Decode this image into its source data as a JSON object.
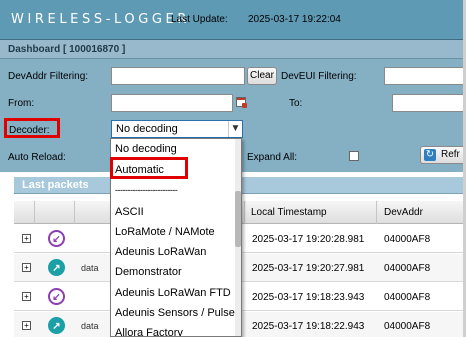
{
  "header": {
    "logo": "WIRELESS-LOGGER",
    "last_update_label": "Last Update:",
    "last_update_value": "2025-03-17 19:22:04"
  },
  "dashboard": {
    "title": "Dashboard [ 100016870 ]"
  },
  "filters": {
    "devaddr_label": "DevAddr Filtering:",
    "clear_label": "Clear",
    "deveui_label": "DevEUI Filtering:",
    "from_label": "From:",
    "to_label": "To:",
    "decoder_label": "Decoder:",
    "decoder_value": "No decoding",
    "auto_reload_label": "Auto Reload:",
    "expand_all_label": "Expand All:",
    "refresh_label": "Refr"
  },
  "dropdown": {
    "items": [
      "No decoding",
      "Automatic",
      "-------------------------",
      "ASCII",
      "LoRaMote / NAMote",
      "Adeunis LoRaWan",
      "Demonstrator",
      "Adeunis LoRaWan FTD",
      "Adeunis Sensors / Pulse",
      "Allora Factory"
    ]
  },
  "packets": {
    "title": "Last packets",
    "columns": {
      "timestamp": "Local Timestamp",
      "devaddr": "DevAddr"
    },
    "rows": [
      {
        "direction": "down",
        "type": "",
        "timestamp": "2025-03-17 19:20:28.981",
        "devaddr": "04000AF8"
      },
      {
        "direction": "up",
        "type": "data",
        "timestamp": "2025-03-17 19:20:27.981",
        "devaddr": "04000AF8"
      },
      {
        "direction": "down",
        "type": "",
        "timestamp": "2025-03-17 19:18:23.943",
        "devaddr": "04000AF8"
      },
      {
        "direction": "up",
        "type": "data",
        "timestamp": "2025-03-17 19:18:22.943",
        "devaddr": "04000AF8"
      }
    ]
  },
  "icons": {
    "expand": "plus-square-icon",
    "downlink": "arrow-down-left-icon",
    "uplink": "arrow-up-right-icon",
    "calendar": "calendar-icon",
    "refresh": "refresh-icon",
    "dropdown_arrow": "chevron-down-icon"
  },
  "colors": {
    "header": "#5f9ab5",
    "panel": "#85b0c4",
    "highlight": "#e00000",
    "downlink": "#8a3fb3",
    "uplink": "#1ba0a6"
  }
}
